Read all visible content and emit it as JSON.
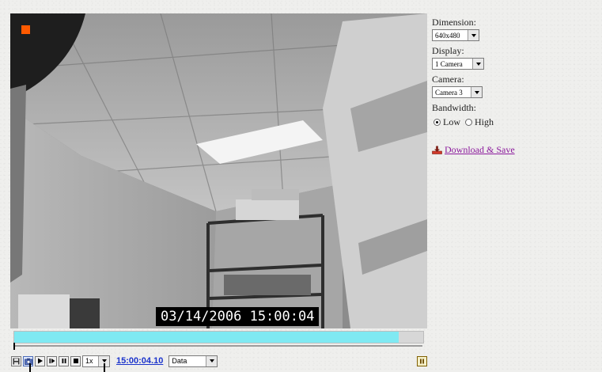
{
  "video": {
    "timestamp": "03/14/2006 15:00:04",
    "recording": true,
    "progress_fraction": 0.94
  },
  "controls": {
    "buttons": [
      "save-icon",
      "snapshot-icon",
      "play-icon",
      "step-forward-icon",
      "pause-icon",
      "stop-icon"
    ],
    "speed": "1x",
    "current_time": "15:00:04.10",
    "info_mode": "Data"
  },
  "panel": {
    "dimension_label": "Dimension:",
    "dimension_value": "640x480",
    "display_label": "Display:",
    "display_value": "1 Camera",
    "camera_label": "Camera:",
    "camera_value": "Camera 3",
    "bandwidth_label": "Bandwidth:",
    "bandwidth_options": [
      "Low",
      "High"
    ],
    "bandwidth_selected": "Low",
    "download_label": "Download & Save"
  },
  "colors": {
    "progress_fill": "#7fe9f2",
    "recording_indicator": "#ff5a00",
    "time_link": "#1a33cc",
    "download_link": "#8b1a9c"
  }
}
